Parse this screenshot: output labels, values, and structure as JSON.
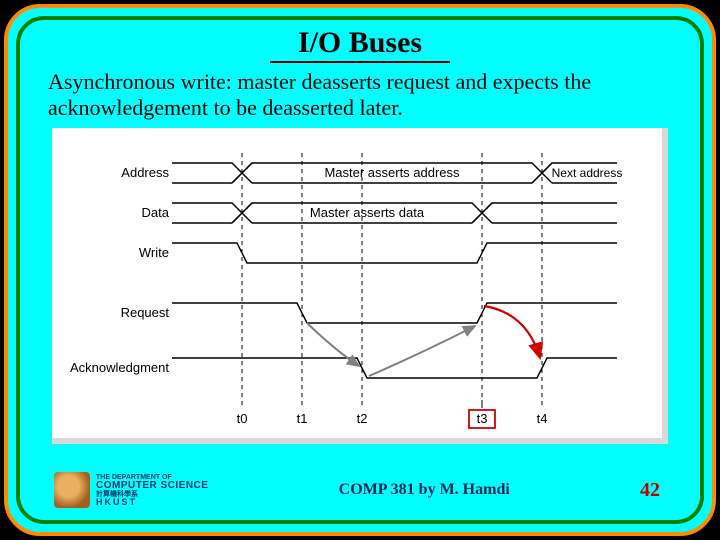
{
  "title": "I/O Buses",
  "description": "Asynchronous write: master deasserts request and expects the acknowledgement to be deasserted later.",
  "signals": {
    "s0": "Address",
    "s1": "Data",
    "s2": "Write",
    "s3": "Request",
    "s4": "Acknowledgment"
  },
  "annotations": {
    "addr_mid": "Master asserts address",
    "addr_next": "Next address",
    "data_mid": "Master asserts data"
  },
  "ticks": {
    "t0": "t0",
    "t1": "t1",
    "t2": "t2",
    "t3": "t3",
    "t4": "t4"
  },
  "footer": {
    "dept_top": "THE DEPARTMENT OF",
    "dept_cs": "COMPUTER SCIENCE",
    "dept_cn": "計算機科學系",
    "dept_hk": "HKUST",
    "course": "COMP 381 by M. Hamdi",
    "page": "42"
  }
}
